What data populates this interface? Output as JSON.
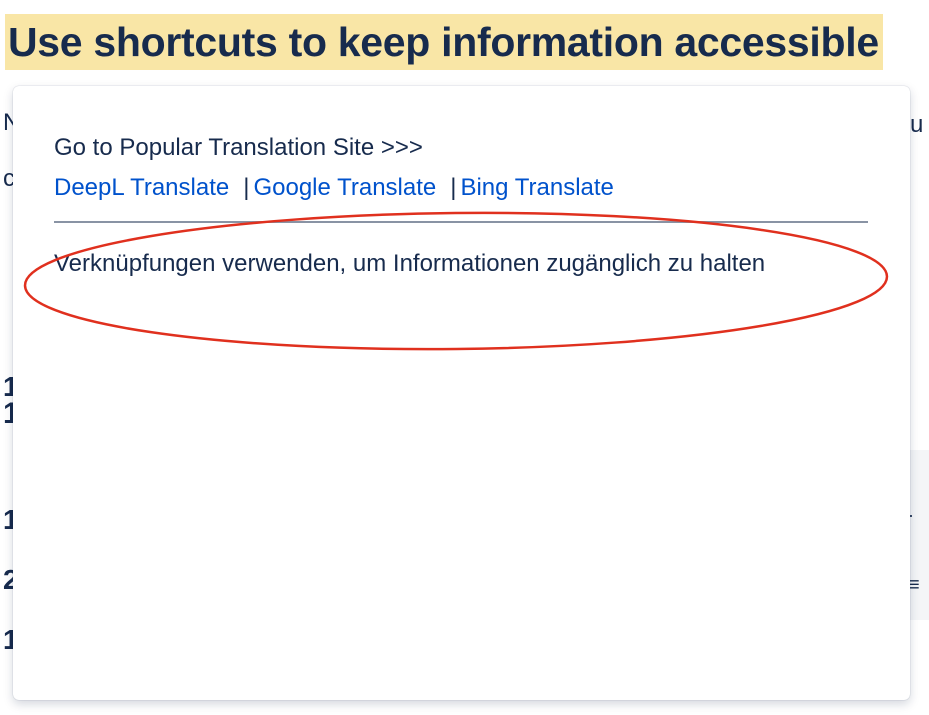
{
  "page": {
    "heading": "Use shortcuts to keep information accessible",
    "heading_highlight_color": "#f9e6a6",
    "fragments": {
      "l1": "N",
      "l2": "c",
      "l3": "1",
      "l4": "1",
      "l5": "1",
      "l6": "2",
      "l7": "1",
      "r1": "u",
      "r2": "·",
      "r3": "≡"
    }
  },
  "popup": {
    "title": "Go to Popular Translation Site >>>",
    "links": [
      {
        "label": "DeepL Translate"
      },
      {
        "label": "Google Translate"
      },
      {
        "label": "Bing Translate"
      }
    ],
    "separator": "|",
    "translation": "Verknüpfungen verwenden, um Informationen zugänglich zu halten",
    "link_color": "#0052cc",
    "annotation_color": "#e0301e"
  }
}
